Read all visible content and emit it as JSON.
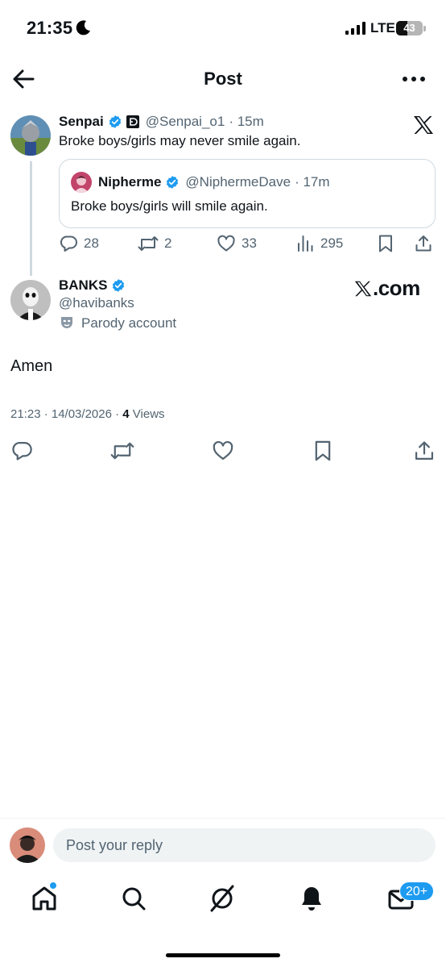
{
  "status_bar": {
    "time": "21:35",
    "network": "LTE",
    "battery": "43",
    "battery_level": 0.43
  },
  "header": {
    "title": "Post"
  },
  "quoted_parent": {
    "name": "Senpai",
    "handle": "@Senpai_o1",
    "time": "· 15m",
    "text": "Broke boys/girls may never smile again.",
    "quote": {
      "name": "Nipherme",
      "handle": "@NiphermeDave",
      "time": "· 17m",
      "text": "Broke boys/girls will smile again."
    },
    "stats": {
      "replies": "28",
      "reposts": "2",
      "likes": "33",
      "views": "295"
    }
  },
  "main_post": {
    "name": "BANKS",
    "handle": "@havibanks",
    "parody_label": "Parody account",
    "watermark": "X.com",
    "text": "Amen",
    "timestamp": "21:23 · 14/03/2026 · ",
    "views_count": "4",
    "views_label": " Views"
  },
  "reply": {
    "placeholder": "Post your reply"
  },
  "bottom_nav": {
    "messages_badge": "20+"
  },
  "colors": {
    "accent": "#1d9bf0",
    "text": "#0f1419",
    "muted": "#536471",
    "border": "#cfd9de"
  },
  "icons": [
    "back-arrow-icon",
    "more-icon",
    "verified-icon",
    "x-logo-icon",
    "reply-icon",
    "repost-icon",
    "like-icon",
    "views-icon",
    "bookmark-icon",
    "share-icon",
    "parody-mask-icon",
    "home-icon",
    "search-icon",
    "grok-icon",
    "notifications-icon",
    "messages-icon"
  ]
}
